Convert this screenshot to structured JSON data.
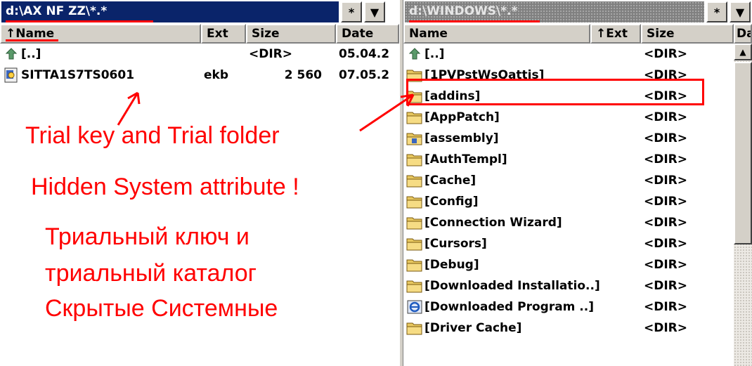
{
  "left_panel": {
    "path": "d:\\AX NF ZZ\\*.*",
    "filter_btn": "*",
    "dropdown_icon": "triangle-down",
    "columns": {
      "name": "↑Name",
      "ext": "Ext",
      "size": "Size",
      "date": "Date"
    },
    "rows": [
      {
        "icon": "up-arrow-icon",
        "name": "[..]",
        "ext": "",
        "size": "<DIR>",
        "date": "05.04.2"
      },
      {
        "icon": "file-icon",
        "name": "SITTA1S7TS0601",
        "ext": "ekb",
        "size": "2 560",
        "date": "07.05.2"
      }
    ]
  },
  "right_panel": {
    "path": "d:\\WINDOWS\\*.*",
    "filter_btn": "*",
    "dropdown_icon": "triangle-down",
    "columns": {
      "name": "Name",
      "ext": "↑Ext",
      "size": "Size",
      "date": "Da"
    },
    "rows": [
      {
        "icon": "up-arrow-icon",
        "name": "[..]",
        "size": "<DIR>"
      },
      {
        "icon": "folder-icon",
        "name": "[1PVPstWsQattis]",
        "size": "<DIR>"
      },
      {
        "icon": "folder-icon",
        "name": "[addins]",
        "size": "<DIR>"
      },
      {
        "icon": "folder-icon",
        "name": "[AppPatch]",
        "size": "<DIR>"
      },
      {
        "icon": "special-folder-icon",
        "name": "[assembly]",
        "size": "<DIR>"
      },
      {
        "icon": "folder-icon",
        "name": "[AuthTempl]",
        "size": "<DIR>"
      },
      {
        "icon": "folder-icon",
        "name": "[Cache]",
        "size": "<DIR>"
      },
      {
        "icon": "folder-icon",
        "name": "[Config]",
        "size": "<DIR>"
      },
      {
        "icon": "folder-icon",
        "name": "[Connection Wizard]",
        "size": "<DIR>"
      },
      {
        "icon": "folder-icon",
        "name": "[Cursors]",
        "size": "<DIR>"
      },
      {
        "icon": "folder-icon",
        "name": "[Debug]",
        "size": "<DIR>"
      },
      {
        "icon": "folder-icon",
        "name": "[Downloaded Installatio..]",
        "size": "<DIR>"
      },
      {
        "icon": "ie-folder-icon",
        "name": "[Downloaded Program ..]",
        "size": "<DIR>"
      },
      {
        "icon": "folder-icon",
        "name": "[Driver Cache]",
        "size": "<DIR>"
      }
    ],
    "scroll_up_icon": "triangle-up"
  },
  "annotations": {
    "line1": "Trial key and Trial folder",
    "line2": "Hidden System attribute !",
    "line3": "Триальный ключ и",
    "line4": "триальный каталог",
    "line5": "Скрытые Системные"
  },
  "colors": {
    "accent": "#ff0000",
    "active_path_bg": "#0a246a",
    "panel_bg": "#ffffff",
    "chrome": "#d4d0c8"
  }
}
